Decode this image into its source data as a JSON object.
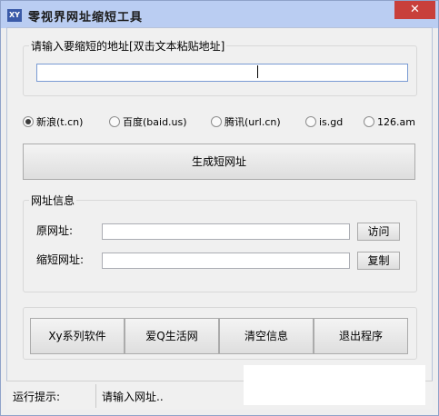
{
  "window": {
    "icon_text": "XY",
    "title": "零视界网址缩短工具",
    "close": "✕"
  },
  "input_group": {
    "legend": "请输入要缩短的地址[双击文本粘贴地址]",
    "value": ""
  },
  "services": [
    {
      "label": "新浪(t.cn)",
      "checked": true
    },
    {
      "label": "百度(baid.us)",
      "checked": false
    },
    {
      "label": "腾讯(url.cn)",
      "checked": false
    },
    {
      "label": "is.gd",
      "checked": false
    },
    {
      "label": "126.am",
      "checked": false
    }
  ],
  "generate_button": "生成短网址",
  "info_group": {
    "legend": "网址信息",
    "original_label": "原网址:",
    "original_value": "",
    "visit_button": "访问",
    "short_label": "缩短网址:",
    "short_value": "",
    "copy_button": "复制"
  },
  "bottom_buttons": [
    "Xy系列软件",
    "爱Q生活网",
    "清空信息",
    "退出程序"
  ],
  "status": {
    "label": "运行提示:",
    "message": "请输入网址.."
  }
}
